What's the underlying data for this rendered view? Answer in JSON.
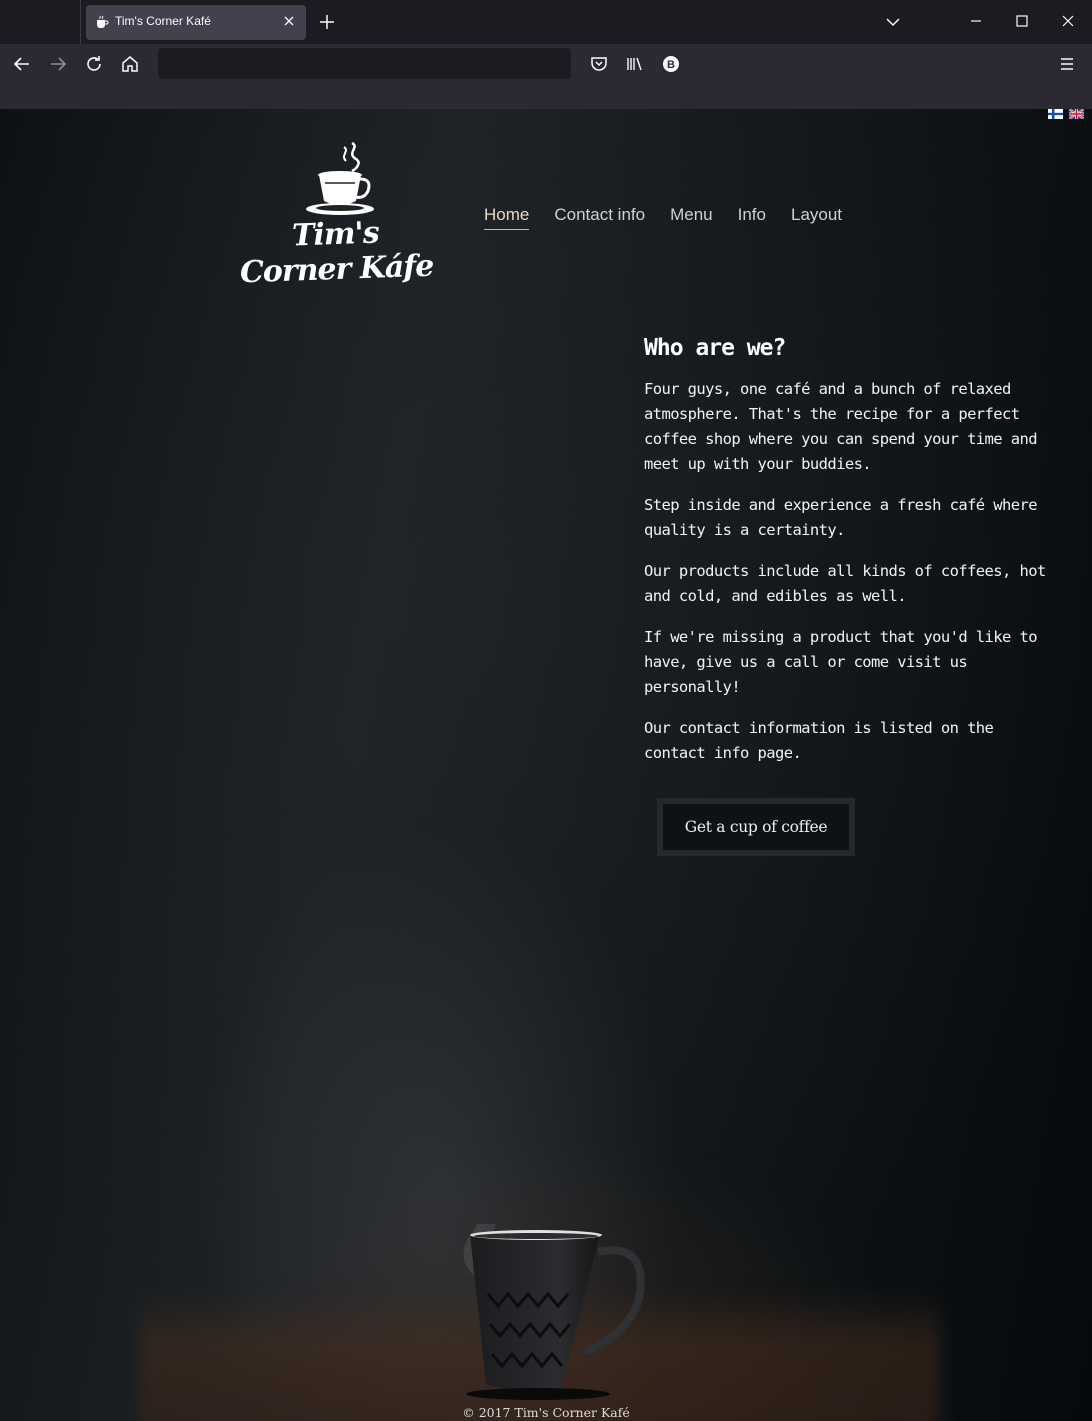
{
  "browser": {
    "tab_title": "Tim's Corner Kafé",
    "url": ""
  },
  "site": {
    "logo_text": "Tim's Corner Káfe",
    "nav": [
      {
        "label": "Home",
        "active": true
      },
      {
        "label": "Contact info"
      },
      {
        "label": "Menu"
      },
      {
        "label": "Info"
      },
      {
        "label": "Layout"
      }
    ],
    "languages": [
      "fi-flag",
      "uk-flag"
    ]
  },
  "content": {
    "heading": "Who are we?",
    "paragraphs": [
      "Four guys, one café and a bunch of relaxed atmosphere. That's the recipe for a perfect coffee shop where you can spend your time and meet up with your buddies.",
      "Step inside and experience a fresh café where quality is a certainty.",
      "Our products include all kinds of coffees, hot and cold, and edibles as well.",
      "If we're missing a product that you'd like to have, give us a call or come visit us personally!",
      "Our contact information is listed on the contact info page."
    ],
    "cta_label": "Get a cup of coffee"
  },
  "footer": {
    "text": "© 2017 Tim's Corner Kafé"
  }
}
